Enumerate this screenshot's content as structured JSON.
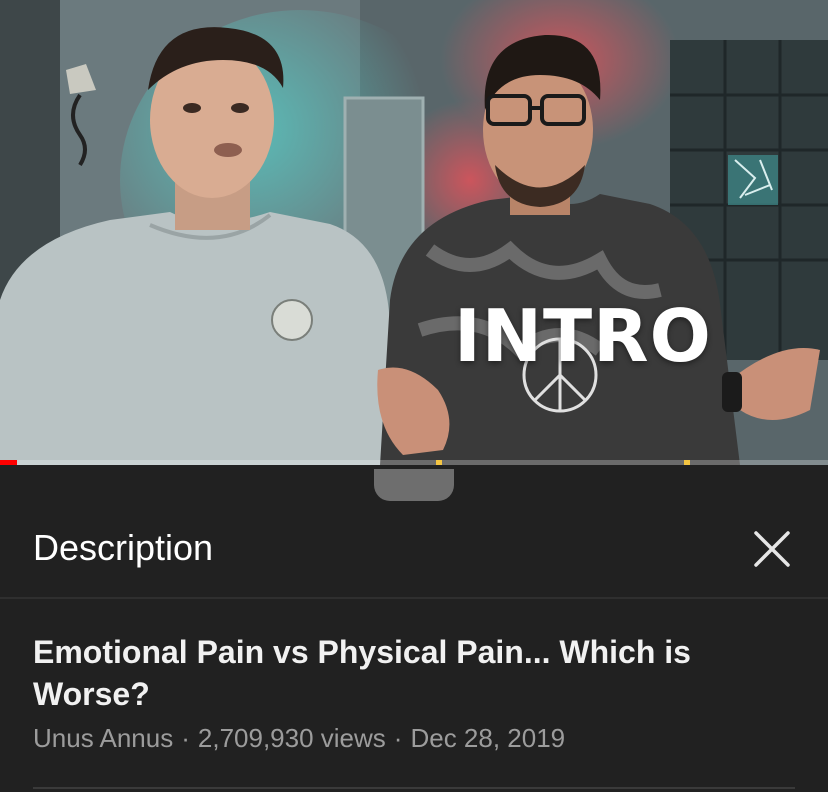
{
  "video": {
    "overlay_text": "INTRO",
    "progress_fraction": 0.02
  },
  "description_panel": {
    "title": "Description",
    "close_icon": "close-icon"
  },
  "video_info": {
    "title": "Emotional Pain vs Physical Pain... Which is Worse?",
    "channel": "Unus Annus",
    "views": "2,709,930 views",
    "date": "Dec 28, 2019",
    "separator": "·"
  },
  "colors": {
    "progress": "#ff0000",
    "chapter_marker": "#f4c542",
    "background": "#212121",
    "meta_text": "#9c9c9c"
  }
}
